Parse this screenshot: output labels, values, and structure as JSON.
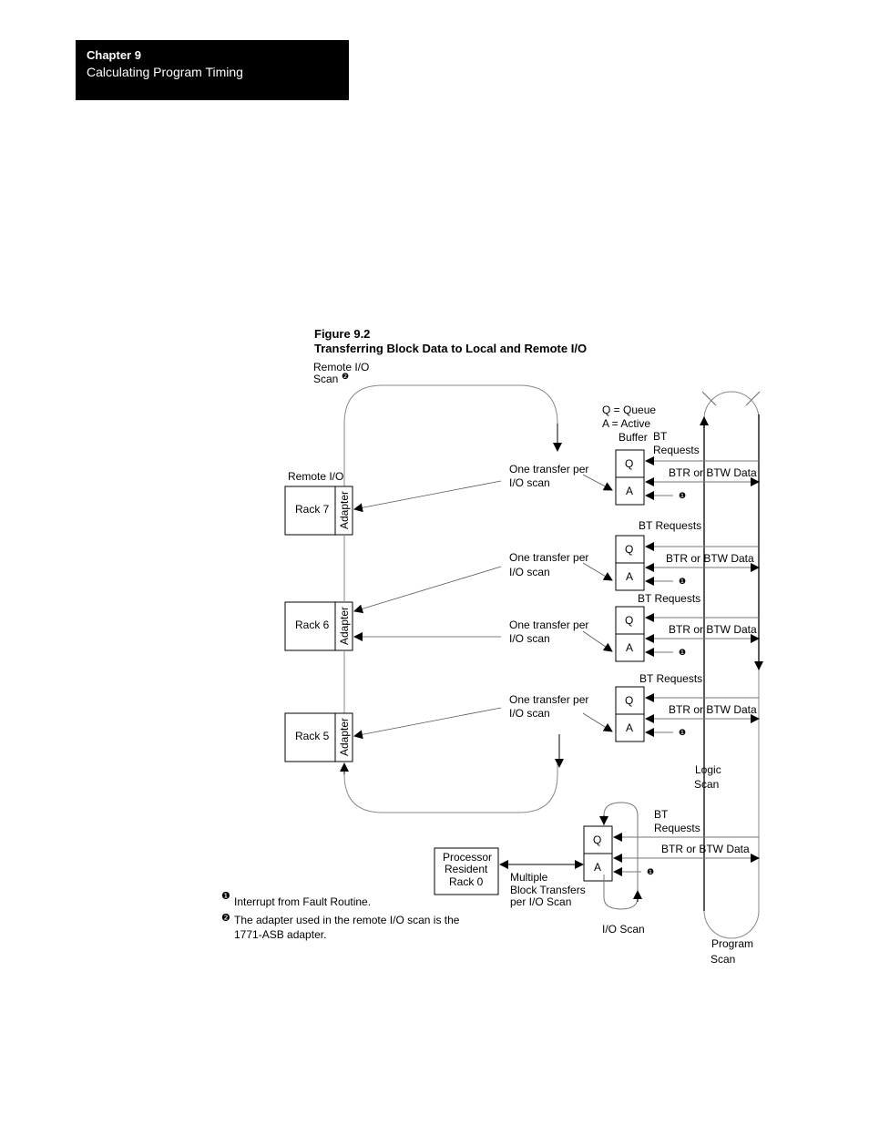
{
  "header": {
    "chapter": "Chapter  9",
    "subtitle": "Calculating Program Timing"
  },
  "figure": {
    "number": "Figure 9.2",
    "title": "Transferring Block Data to Local and Remote I/O"
  },
  "diagram": {
    "remote_io_scan_label": [
      "Remote I/O",
      "Scan"
    ],
    "remote_io_label": "Remote I/O",
    "legend": [
      "Q = Queue",
      "A = Active",
      "Buffer"
    ],
    "racks": [
      {
        "name": "Rack 7",
        "adapter": "Adapter"
      },
      {
        "name": "Rack 6",
        "adapter": "Adapter"
      },
      {
        "name": "Rack 5",
        "adapter": "Adapter"
      }
    ],
    "transfer_label": [
      "One transfer per",
      "I/O scan"
    ],
    "buffers": [
      {
        "requests": [
          "BT",
          "Requests"
        ],
        "q": "Q",
        "a": "A",
        "data": "BTR or BTW Data"
      },
      {
        "requests": [
          "BT Requests"
        ],
        "q": "Q",
        "a": "A",
        "data": "BTR or BTW Data"
      },
      {
        "requests": [
          "BT Requests"
        ],
        "q": "Q",
        "a": "A",
        "data": "BTR or BTW Data"
      },
      {
        "requests": [
          "BT Requests"
        ],
        "q": "Q",
        "a": "A",
        "data": "BTR or BTW Data"
      },
      {
        "requests": [
          "BT",
          "Requests"
        ],
        "q": "Q",
        "a": "A",
        "data": "BTR or BTW Data"
      }
    ],
    "logic_scan": [
      "Logic",
      "Scan"
    ],
    "program_scan": [
      "Program",
      "Scan"
    ],
    "io_scan": "I/O Scan",
    "local_rack": [
      "Processor",
      "Resident",
      "Rack 0"
    ],
    "multiple_transfers": [
      "Multiple",
      "Block Transfers",
      "per I/O Scan"
    ],
    "note_marker_1": "❶",
    "note_marker_2": "❷"
  },
  "notes": {
    "note1_marker": "❶",
    "note1": "Interrupt from Fault Routine.",
    "note2_marker": "❷",
    "note2": "The adapter used in the remote I/O scan is the 1771-ASB adapter."
  }
}
